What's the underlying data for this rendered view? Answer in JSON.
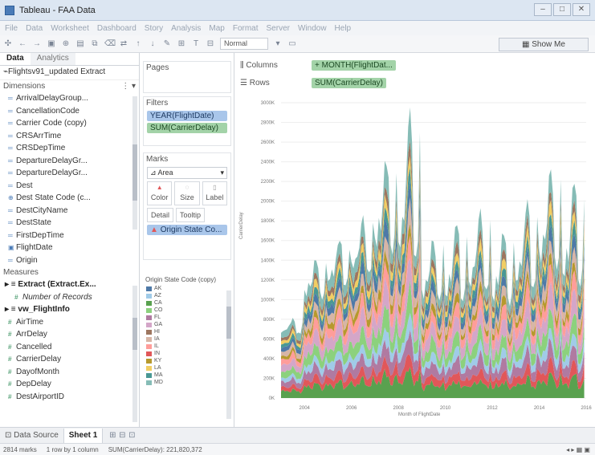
{
  "window": {
    "title": "Tableau - FAA Data"
  },
  "menu": [
    "File",
    "Data",
    "Worksheet",
    "Dashboard",
    "Story",
    "Analysis",
    "Map",
    "Format",
    "Server",
    "Window",
    "Help"
  ],
  "toolbar": {
    "fit": "Normal",
    "show_me": "Show Me"
  },
  "data_pane": {
    "tabs": [
      "Data",
      "Analytics"
    ],
    "datasource": "Flightsv91_updated Extract",
    "dimensions_header": "Dimensions",
    "dimensions": [
      "ArrivalDelayGroup...",
      "CancellationCode",
      "Carrier Code (copy)",
      "CRSArrTime",
      "CRSDepTime",
      "DepartureDelayGr...",
      "DepartureDelayGr...",
      "Dest",
      "Dest State Code (c...",
      "DestCityName",
      "DestState",
      "FirstDepTime",
      "FlightDate",
      "Origin"
    ],
    "measures_header": "Measures",
    "measure_groups": [
      {
        "name": "Extract (Extract.Ex...",
        "items": [
          "Number of Records"
        ]
      },
      {
        "name": "vw_FlightInfo",
        "items": [
          "AirTime",
          "ArrDelay",
          "Cancelled",
          "CarrierDelay",
          "DayofMonth",
          "DepDelay",
          "DestAirportID"
        ]
      }
    ]
  },
  "cards": {
    "pages_label": "Pages",
    "filters_label": "Filters",
    "filters": [
      "YEAR(FlightDate)",
      "SUM(CarrierDelay)"
    ],
    "marks_label": "Marks",
    "mark_type": "Area",
    "mark_buttons": [
      "Color",
      "Size",
      "Label"
    ],
    "mark_buttons2": [
      "Detail",
      "Tooltip"
    ],
    "color_pill": "Origin State Co...",
    "legend_title": "Origin State Code (copy)",
    "legend": [
      {
        "code": "AK",
        "color": "#4e79a7"
      },
      {
        "code": "AZ",
        "color": "#a0cbe8"
      },
      {
        "code": "CA",
        "color": "#59a14f"
      },
      {
        "code": "CO",
        "color": "#8cd17d"
      },
      {
        "code": "FL",
        "color": "#b07aa1"
      },
      {
        "code": "GA",
        "color": "#d4a6c8"
      },
      {
        "code": "HI",
        "color": "#9d7660"
      },
      {
        "code": "IA",
        "color": "#d7b5a6"
      },
      {
        "code": "IL",
        "color": "#ff9d9a"
      },
      {
        "code": "IN",
        "color": "#e15759"
      },
      {
        "code": "KY",
        "color": "#b6992d"
      },
      {
        "code": "LA",
        "color": "#f1ce63"
      },
      {
        "code": "MA",
        "color": "#499894"
      },
      {
        "code": "MD",
        "color": "#86bcb6"
      }
    ]
  },
  "shelves": {
    "columns_label": "Columns",
    "columns_pill": "MONTH(FlightDat...",
    "rows_label": "Rows",
    "rows_pill": "SUM(CarrierDelay)"
  },
  "chart_data": {
    "type": "area",
    "title": "",
    "xlabel": "Month of FlightDate",
    "ylabel": "CarrierDelay",
    "ylim": [
      0,
      3000000
    ],
    "yticks": [
      "0K",
      "200K",
      "400K",
      "600K",
      "800K",
      "1000K",
      "1200K",
      "1400K",
      "1600K",
      "1800K",
      "2000K",
      "2200K",
      "2400K",
      "2600K",
      "2800K",
      "3000K"
    ],
    "xticks": [
      "2004",
      "2006",
      "2008",
      "2010",
      "2012",
      "2014",
      "2016"
    ],
    "x_range": [
      2003,
      2016
    ],
    "stacked": true,
    "series": [
      {
        "name": "CA",
        "color": "#59a14f",
        "share": 0.1
      },
      {
        "name": "IN",
        "color": "#e15759",
        "share": 0.06
      },
      {
        "name": "FL",
        "color": "#b07aa1",
        "share": 0.08
      },
      {
        "name": "AZ",
        "color": "#a0cbe8",
        "share": 0.06
      },
      {
        "name": "CO",
        "color": "#8cd17d",
        "share": 0.09
      },
      {
        "name": "GA",
        "color": "#d4a6c8",
        "share": 0.1
      },
      {
        "name": "IL",
        "color": "#ff9d9a",
        "share": 0.08
      },
      {
        "name": "KY",
        "color": "#b6992d",
        "share": 0.05
      },
      {
        "name": "IA",
        "color": "#d7b5a6",
        "share": 0.07
      },
      {
        "name": "AK",
        "color": "#4e79a7",
        "share": 0.06
      },
      {
        "name": "MA",
        "color": "#499894",
        "share": 0.05
      },
      {
        "name": "LA",
        "color": "#f1ce63",
        "share": 0.05
      },
      {
        "name": "HI",
        "color": "#9d7660",
        "share": 0.05
      },
      {
        "name": "MD",
        "color": "#86bcb6",
        "share": 0.1
      }
    ],
    "total_by_year": [
      {
        "year": 2003,
        "low": 600000,
        "high": 800000
      },
      {
        "year": 2004,
        "low": 900000,
        "high": 1400000
      },
      {
        "year": 2005,
        "low": 1000000,
        "high": 1600000
      },
      {
        "year": 2006,
        "low": 1100000,
        "high": 1800000
      },
      {
        "year": 2007,
        "low": 1200000,
        "high": 2400000
      },
      {
        "year": 2008,
        "low": 900000,
        "high": 2900000
      },
      {
        "year": 2009,
        "low": 800000,
        "high": 1600000
      },
      {
        "year": 2010,
        "low": 700000,
        "high": 1800000
      },
      {
        "year": 2011,
        "low": 800000,
        "high": 1900000
      },
      {
        "year": 2012,
        "low": 700000,
        "high": 1700000
      },
      {
        "year": 2013,
        "low": 800000,
        "high": 2000000
      },
      {
        "year": 2014,
        "low": 1000000,
        "high": 2300000
      },
      {
        "year": 2015,
        "low": 800000,
        "high": 2200000
      }
    ]
  },
  "bottom_tabs": [
    "Data Source",
    "Sheet 1"
  ],
  "status": [
    "2814 marks",
    "1 row by 1 column",
    "SUM(CarrierDelay): 221,820,372"
  ]
}
